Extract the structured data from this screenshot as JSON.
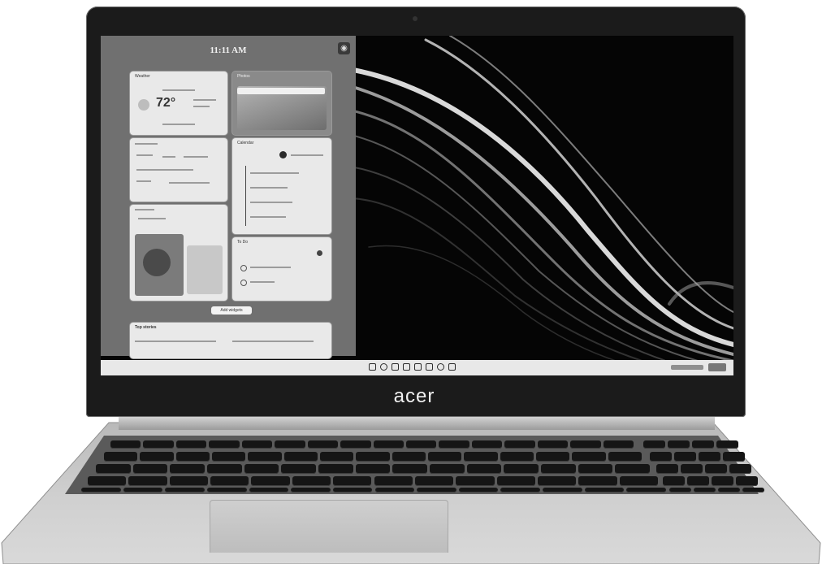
{
  "screen": {
    "clock": "11:11 AM",
    "widgets": {
      "weather": {
        "title": "Weather",
        "temperature": "72°"
      },
      "photos": {
        "title": "Photos"
      },
      "calendar": {
        "title": "Calendar"
      },
      "todo": {
        "title": "To Do"
      },
      "news_button": "Add widgets",
      "top_stories": "Top stories"
    }
  },
  "brand": {
    "logo": "acer"
  },
  "colors": {
    "panel": "#707070",
    "taskbar": "#e8e8e8",
    "lid": "#1b1b1b",
    "chassis": "#c8c8c8"
  },
  "icons": [
    "start-icon",
    "search-icon",
    "task-view-icon",
    "widgets-icon",
    "chat-icon",
    "file-explorer-icon",
    "edge-icon",
    "store-icon"
  ]
}
